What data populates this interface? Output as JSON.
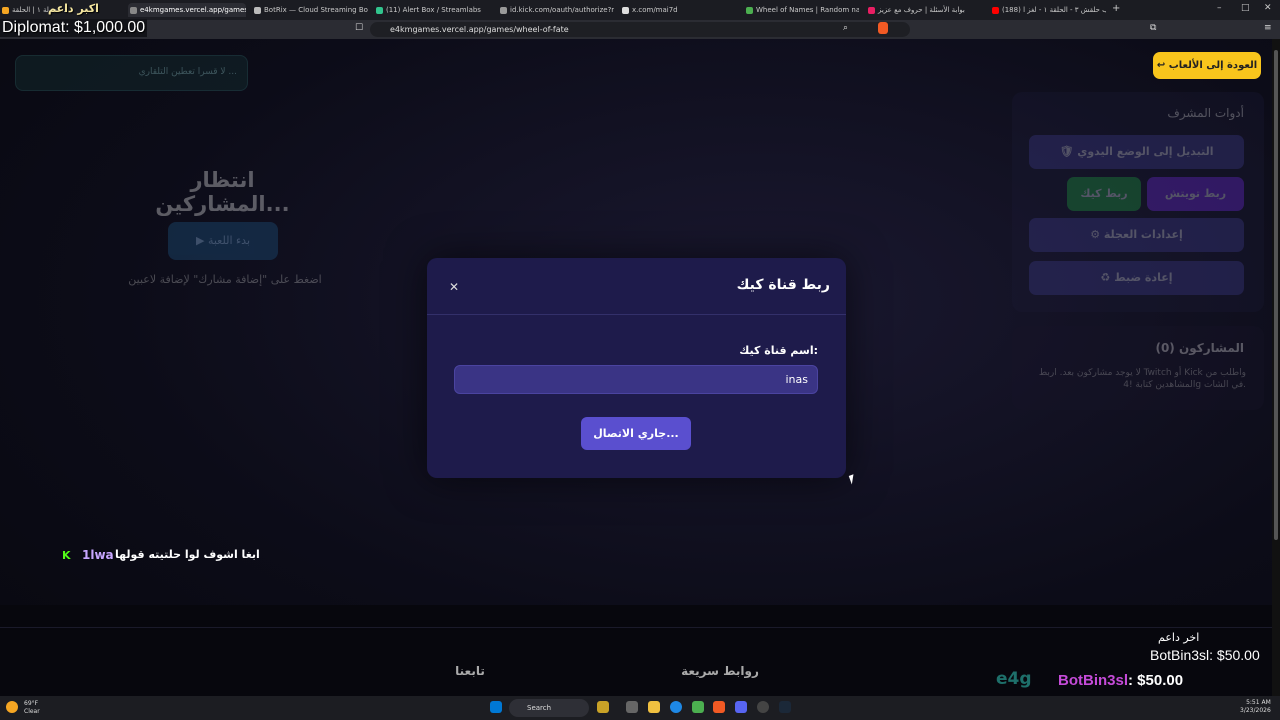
{
  "browser": {
    "tabs": [
      {
        "title": "جولة ١ | الحلقة ...",
        "active": false
      },
      {
        "title": "e4kmgames.vercel.app/games/",
        "active": true
      },
      {
        "title": "BotRix — Cloud Streaming Bot for Tw",
        "active": false
      },
      {
        "title": "(11) Alert Box / Streamlabs",
        "active": false
      },
      {
        "title": "id.kick.com/oauth/authorize?respon",
        "active": false
      },
      {
        "title": "x.com/mai7d",
        "active": false
      },
      {
        "title": "Wheel of Names | Random name pic",
        "active": false
      },
      {
        "title": "بوابة الأسئلة | حروف مع عزيز",
        "active": false
      },
      {
        "title": "(188) التقبيب حلقش ٣ - الحلقة ١ - لغز ا",
        "active": false
      }
    ],
    "url": "e4kmgames.vercel.app/games/wheel-of-fate"
  },
  "overlay": {
    "top_donor_label": "اكبر داعم",
    "top_donor": "Diplomat: $1,000.00",
    "last_supporter_label": "اخر داعم",
    "last_supporter": "BotBin3sl: $50.00",
    "big_name": "BotBin3sl",
    "big_amount": ": $50.00",
    "brand": "e4g"
  },
  "page": {
    "top_note": "لا قسرا تعطين التلقاري ...",
    "back_button": "↩ العودة إلى الألعاب",
    "waiting_title": "انتظار المشاركين...",
    "start_button": "▶ بدء اللعبة",
    "hint": "اضغط على \"إضافة مشارك\" لإضافة لاعبين",
    "tools": {
      "title": "أدوات المشرف",
      "manual_mode": "🛡 التبديل إلى الوضع اليدوي",
      "twitch": "ربط تويتش",
      "kick": "ربط كيك",
      "wheel_settings": "⚙ إعدادات العجلة",
      "reset": "♻ إعادة ضبط"
    },
    "participants": {
      "title": "المشاركون (0)",
      "note": "لا يوجد مشاركون بعد. اربط Twitch أو Kick واطلب من المشاهدين كتابة !4g في الشات."
    }
  },
  "modal": {
    "title": "ربط قناة كيك",
    "field_label": "اسم قناة كيك:",
    "channel_value": "inas",
    "connect_button": "جاري الاتصال..."
  },
  "chat": {
    "user": "1lwa",
    "message": "ابغا اشوف لوا حلتيته قولها"
  },
  "footer": {
    "follow": "تابعنا",
    "quick_links": "روابط سريعة"
  },
  "taskbar": {
    "weather_temp": "69°F",
    "weather_desc": "Clear",
    "search": "Search",
    "time": "5:51 AM",
    "date": "3/23/2026"
  },
  "colors": {
    "accent": "#5a4fcf",
    "back_button": "#f8c51c",
    "kick_green": "#53fc18",
    "twitch_purple": "#6d28d9"
  }
}
